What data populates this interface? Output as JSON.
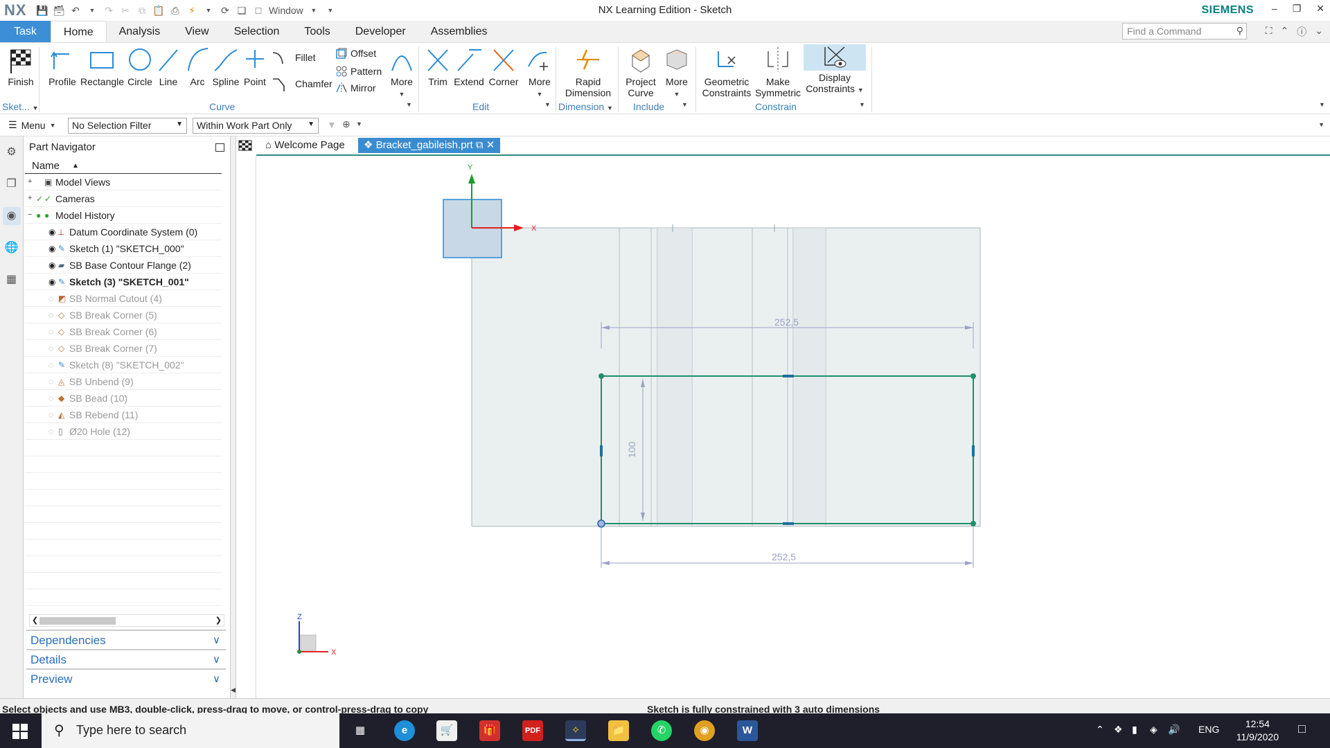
{
  "window": {
    "title": "NX Learning Edition - Sketch",
    "app_logo": "NX",
    "brand": "SIEMENS",
    "window_menu_label": "Window"
  },
  "tabs": [
    "Task",
    "Home",
    "Analysis",
    "View",
    "Selection",
    "Tools",
    "Developer",
    "Assemblies"
  ],
  "active_tab": "Home",
  "find_command_placeholder": "Find a Command",
  "ribbon": {
    "finish": "Finish",
    "sketch_group": "Sket...",
    "profile": "Profile",
    "rectangle": "Rectangle",
    "circle": "Circle",
    "line": "Line",
    "arc": "Arc",
    "spline": "Spline",
    "point": "Point",
    "fillet": "Fillet",
    "chamfer": "Chamfer",
    "offset": "Offset",
    "pattern": "Pattern",
    "mirror": "Mirror",
    "more_curve": "More",
    "curve_group": "Curve",
    "trim": "Trim",
    "extend": "Extend",
    "corner": "Corner",
    "more_edit": "More",
    "edit_group": "Edit",
    "rapid_dimension_1": "Rapid",
    "rapid_dimension_2": "Dimension",
    "dimension_group": "Dimension",
    "project_curve_1": "Project",
    "project_curve_2": "Curve",
    "more_include": "More",
    "include_group": "Include",
    "geometric_constraints_1": "Geometric",
    "geometric_constraints_2": "Constraints",
    "make_symmetric_1": "Make",
    "make_symmetric_2": "Symmetric",
    "display_constraints_1": "Display",
    "display_constraints_2": "Constraints",
    "constrain_group": "Constrain"
  },
  "selection_bar": {
    "menu": "Menu",
    "filter": "No Selection Filter",
    "scope": "Within Work Part Only"
  },
  "navigator": {
    "title": "Part Navigator",
    "column": "Name",
    "rows": [
      {
        "label": "Model Views",
        "state": "normal",
        "icon_name": "views-icon"
      },
      {
        "label": "Cameras",
        "state": "normal",
        "icon_name": "camera-icon"
      },
      {
        "label": "Model History",
        "state": "normal",
        "icon_name": "history-icon"
      },
      {
        "label": "Datum Coordinate System (0)",
        "state": "normal",
        "icon_name": "datum-csys-icon"
      },
      {
        "label": "Sketch (1) \"SKETCH_000\"",
        "state": "normal",
        "icon_name": "sketch-icon"
      },
      {
        "label": "SB Base Contour Flange (2)",
        "state": "normal",
        "icon_name": "contour-flange-icon"
      },
      {
        "label": "Sketch (3) \"SKETCH_001\"",
        "state": "bold",
        "icon_name": "sketch-icon"
      },
      {
        "label": "SB Normal Cutout (4)",
        "state": "dim",
        "icon_name": "cutout-icon"
      },
      {
        "label": "SB Break Corner (5)",
        "state": "dim",
        "icon_name": "break-corner-icon"
      },
      {
        "label": "SB Break Corner (6)",
        "state": "dim",
        "icon_name": "break-corner-icon"
      },
      {
        "label": "SB Break Corner (7)",
        "state": "dim",
        "icon_name": "break-corner-icon"
      },
      {
        "label": "Sketch (8) \"SKETCH_002\"",
        "state": "dim",
        "icon_name": "sketch-icon"
      },
      {
        "label": "SB Unbend (9)",
        "state": "dim",
        "icon_name": "unbend-icon"
      },
      {
        "label": "SB Bead (10)",
        "state": "dim",
        "icon_name": "bead-icon"
      },
      {
        "label": "SB Rebend (11)",
        "state": "dim",
        "icon_name": "rebend-icon"
      },
      {
        "label": "Ø20 Hole (12)",
        "state": "dim",
        "icon_name": "hole-icon"
      }
    ],
    "sections": [
      "Dependencies",
      "Details",
      "Preview"
    ]
  },
  "doc_tabs": {
    "welcome": "Welcome Page",
    "part": "Bracket_gabileish.prt"
  },
  "canvas": {
    "dim_top": "252,5",
    "dim_bottom": "252,5",
    "dim_vertical": "100",
    "axis_x": "X",
    "axis_y": "Y",
    "axis_z": "Z",
    "triad_x": "X",
    "triad_z": "Z"
  },
  "status": {
    "left": "Select objects and use MB3, double-click, press-drag to move, or control-press-drag to copy",
    "right": "Sketch is fully constrained with 3 auto dimensions"
  },
  "taskbar": {
    "search_placeholder": "Type here to search",
    "language": "ENG",
    "time": "12:54",
    "date": "11/9/2020",
    "pdf_label": "PDF",
    "word_label": "W"
  },
  "colors": {
    "accent": "#3c8fd6",
    "sketch_green": "#1f8f6a",
    "dim_color": "#9aa3c6",
    "axis_red": "#e02020",
    "axis_green": "#1d9a2a",
    "axis_blue": "#2040d0"
  }
}
